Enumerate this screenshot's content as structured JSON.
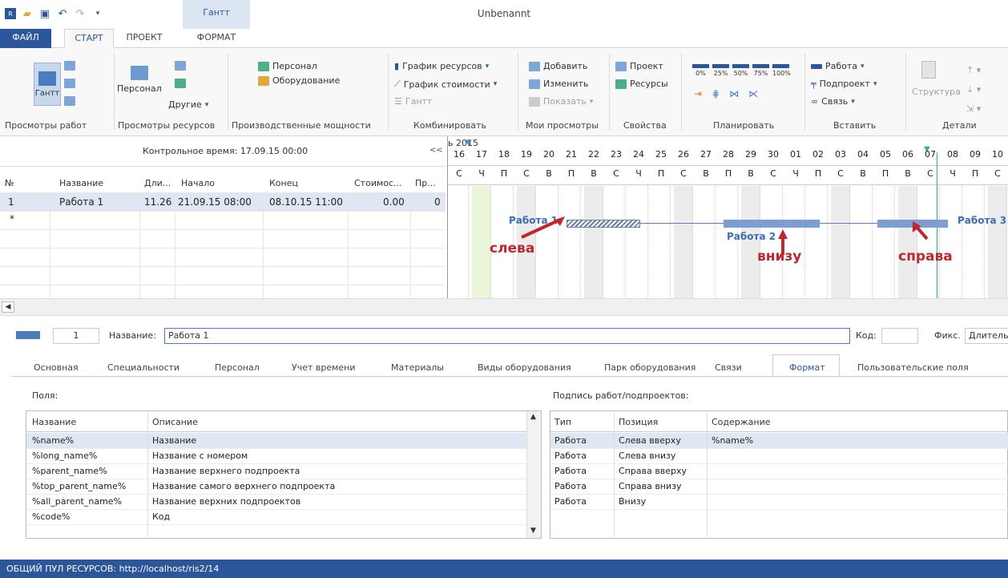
{
  "window": {
    "title": "Unbenannt",
    "context_tab": "Гантт"
  },
  "tabs": [
    "ФАЙЛ",
    "СТАРТ",
    "ПРОЕКТ",
    "ФОРМАТ"
  ],
  "ribbon": {
    "gantt_btn": "Гантт",
    "views_work": "Просмотры работ",
    "personal_btn": "Персонал",
    "others_btn": "Другие",
    "views_res": "Просмотры ресурсов",
    "cap_personal": "Персонал",
    "cap_equipment": "Оборудование",
    "capacities": "Производственные мощности",
    "res_graph": "График ресурсов",
    "cost_graph": "График стоимости",
    "gantt_small": "Гантт",
    "combine": "Комбинировать",
    "add": "Добавить",
    "edit": "Изменить",
    "show": "Показать",
    "my_views": "Мои просмотры",
    "project": "Проект",
    "resources": "Ресурсы",
    "properties": "Свойства",
    "pct": [
      "0%",
      "25%",
      "50%",
      "75%",
      "100%"
    ],
    "plan": "Планировать",
    "work": "Работа",
    "subproject": "Подпроект",
    "link": "Связь",
    "insert": "Вставить",
    "structure": "Структура",
    "details": "Детали"
  },
  "grid": {
    "control_time": "Контрольное время: 17.09.15 00:00",
    "collapse": "<<",
    "headers": [
      "№",
      "Название",
      "Дли...",
      "Начало",
      "Конец",
      "Стоимос...",
      "Пр..."
    ],
    "row": {
      "no": "1",
      "name": "Работа 1",
      "dur": "11.26",
      "start": "21.09.15 08:00",
      "end": "08.10.15 11:00",
      "cost": "0.00",
      "pr": "0"
    },
    "new_row": "*"
  },
  "chart": {
    "month": "ь 2015",
    "days": [
      "16",
      "17",
      "18",
      "19",
      "20",
      "21",
      "22",
      "23",
      "24",
      "25",
      "26",
      "27",
      "28",
      "29",
      "30",
      "01",
      "02",
      "03",
      "04",
      "05",
      "06",
      "07",
      "08",
      "09",
      "10"
    ],
    "weekdays": [
      "С",
      "Ч",
      "П",
      "С",
      "В",
      "П",
      "В",
      "С",
      "Ч",
      "П",
      "С",
      "В",
      "П",
      "В",
      "С",
      "Ч",
      "П",
      "С",
      "В",
      "П",
      "В",
      "С",
      "Ч",
      "П",
      "С"
    ],
    "bars": [
      "Работа 1",
      "Работа 2",
      "Работа 3"
    ],
    "annotations": [
      "слева",
      "внизу",
      "справа"
    ]
  },
  "detail": {
    "id": "1",
    "name_label": "Название:",
    "name_value": "Работа 1",
    "code_label": "Код:",
    "fix_label": "Фикс.",
    "fix_value": "Длитель",
    "tabs": [
      "Основная",
      "Специальности",
      "Персонал",
      "Учет времени",
      "Материалы",
      "Виды оборудования",
      "Парк оборудования",
      "Связи",
      "Формат",
      "Пользовательские поля"
    ],
    "fields_label": "Поля:",
    "caption_label": "Подпись работ/подпроектов:",
    "fields_headers": [
      "Название",
      "Описание"
    ],
    "fields": [
      {
        "name": "%name%",
        "desc": "Название"
      },
      {
        "name": "%long_name%",
        "desc": "Название с номером"
      },
      {
        "name": "%parent_name%",
        "desc": "Название верхнего подпроекта"
      },
      {
        "name": "%top_parent_name%",
        "desc": "Название самого верхнего подпроекта"
      },
      {
        "name": "%all_parent_name%",
        "desc": "Название верхних подпроектов"
      },
      {
        "name": "%code%",
        "desc": "Код"
      }
    ],
    "caption_headers": [
      "Тип",
      "Позиция",
      "Содержание"
    ],
    "captions": [
      {
        "type": "Работа",
        "pos": "Слева вверху",
        "content": "%name%"
      },
      {
        "type": "Работа",
        "pos": "Слева внизу",
        "content": ""
      },
      {
        "type": "Работа",
        "pos": "Справа вверху",
        "content": ""
      },
      {
        "type": "Работа",
        "pos": "Справа внизу",
        "content": ""
      },
      {
        "type": "Работа",
        "pos": "Внизу",
        "content": ""
      }
    ]
  },
  "status": "ОБЩИЙ ПУЛ РЕСУРСОВ: http://localhost/ris2/14"
}
